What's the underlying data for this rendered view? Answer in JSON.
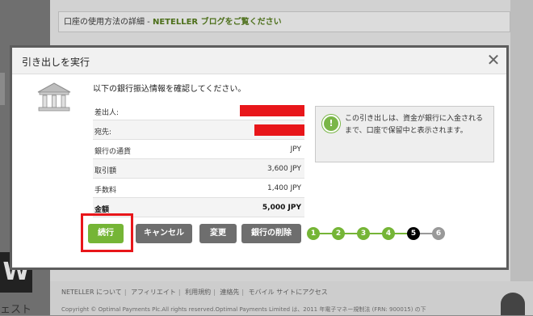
{
  "background": {
    "top_bar_text": "口座の使用方法の詳細 - ",
    "top_bar_link": "NETELLER ブログをご覧ください",
    "left_glyph": "W",
    "left_small_text": "ェスト",
    "footer_links": [
      "NETELLER について",
      "アフィリエイト",
      "利用規約",
      "連絡先",
      "モバイル サイトにアクセス"
    ],
    "copyright": "Copyright © Optimal Payments Plc.All rights reserved.Optimal Payments Limited は、2011 年電子マネー規制法 (FRN: 900015) の下"
  },
  "modal": {
    "title": "引き出しを実行",
    "close_icon": "close-icon",
    "intro": "以下の銀行振込情報を確認してください。",
    "rows": [
      {
        "label": "差出人:",
        "value": "",
        "redacted": true,
        "redact_width": 80
      },
      {
        "label": "宛先:",
        "value": "",
        "redacted": true,
        "redact_width": 62
      },
      {
        "label": "銀行の通貨",
        "value": "JPY"
      },
      {
        "label": "取引額",
        "value": "3,600 JPY"
      },
      {
        "label": "手数料",
        "value": "1,400 JPY"
      },
      {
        "label": "金額",
        "value": "5,000 JPY",
        "total": true
      }
    ],
    "note": {
      "icon": "exclamation-icon",
      "text": "この引き出しは、資金が銀行に入金されるまで、口座で保留中と表示されます。"
    },
    "buttons": {
      "continue": "続行",
      "cancel": "キャンセル",
      "change": "変更",
      "delete_bank": "銀行の削除"
    },
    "steps": {
      "labels": [
        "1",
        "2",
        "3",
        "4",
        "5",
        "6"
      ],
      "current": 5
    }
  },
  "colors": {
    "accent_green": "#75b536",
    "highlight_red": "#e8161a",
    "button_gray": "#6e6e6e"
  }
}
